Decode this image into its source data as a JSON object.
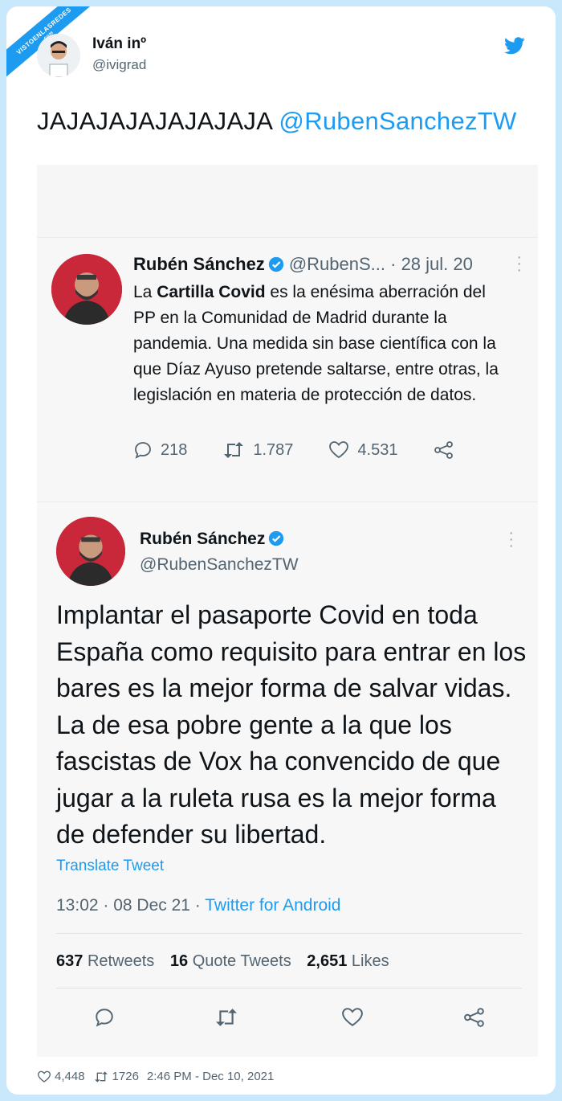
{
  "watermark": {
    "line1": "VISTOENLASREDES",
    "line2": ".com"
  },
  "author": {
    "name": "Iván inº",
    "handle": "@ivigrad"
  },
  "tweet": {
    "text_plain": "JAJAJAJAJAJAJAJA ",
    "mention": "@RubenSanchezTW"
  },
  "quoted_tweet": {
    "name": "Rubén Sánchez",
    "handle_truncated": "@RubenS...",
    "date": "· 28 jul. 20",
    "body_prefix": "La ",
    "body_bold": "Cartilla Covid",
    "body_rest": " es la enésima aberración del PP en la Comunidad de Madrid durante la pandemia. Una medida sin base científica con la que Díaz Ayuso pretende saltarse, entre otras, la legislación en materia de protección de datos.",
    "replies": "218",
    "retweets": "1.787",
    "likes": "4.531"
  },
  "main_tweet": {
    "name": "Rubén Sánchez",
    "handle": "@RubenSanchezTW",
    "body": "Implantar el pasaporte Covid en toda España como requisito para entrar en los bares es la mejor forma de salvar vidas. La de esa pobre gente a la que los fascistas de Vox ha convencido de que jugar a la ruleta rusa es la mejor forma de defender su libertad.",
    "translate": "Translate Tweet",
    "timestamp": "13:02 · 08 Dec 21 · ",
    "source": "Twitter for Android",
    "retweets_count": "637",
    "retweets_label": "Retweets",
    "quotes_count": "16",
    "quotes_label": "Quote Tweets",
    "likes_count": "2,651",
    "likes_label": "Likes"
  },
  "footer": {
    "likes": "4,448",
    "retweets": "1726",
    "timestamp": "2:46 PM - Dec 10, 2021"
  },
  "colors": {
    "accent": "#1d9bf0",
    "text": "#0f1419",
    "muted": "#536471",
    "background": "#c9e8fb"
  }
}
